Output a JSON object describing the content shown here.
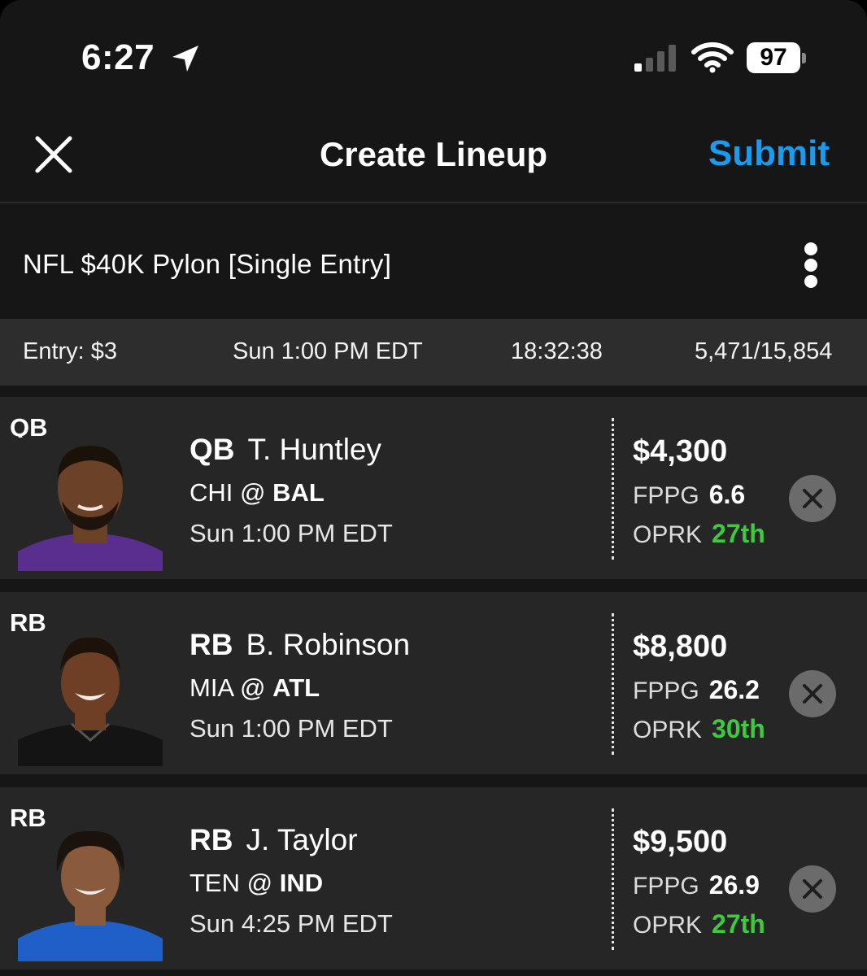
{
  "status_bar": {
    "time": "6:27",
    "battery": "97",
    "icons": [
      "location-arrow-icon",
      "cellular-signal-icon",
      "wifi-icon",
      "battery-icon"
    ]
  },
  "nav": {
    "title": "Create Lineup",
    "submit_label": "Submit",
    "close_icon": "close-icon",
    "accent_color": "#1a9bf0"
  },
  "contest": {
    "name": "NFL $40K Pylon [Single Entry]",
    "more_icon": "more-vertical-icon"
  },
  "info_bar": {
    "entry": "Entry: $3",
    "start_time": "Sun 1:00 PM EDT",
    "countdown": "18:32:38",
    "entries": "5,471/15,854"
  },
  "players": [
    {
      "slot": "QB",
      "position": "QB",
      "name": "T. Huntley",
      "away": "CHI @",
      "home": "BAL",
      "game_time": "Sun 1:00 PM EDT",
      "salary": "$4,300",
      "fppg_label": "FPPG",
      "fppg": "6.6",
      "oprk_label": "OPRK",
      "oprk": "27th",
      "jersey_color": "#5a2e8f"
    },
    {
      "slot": "RB",
      "position": "RB",
      "name": "B. Robinson",
      "away": "MIA @",
      "home": "ATL",
      "game_time": "Sun 1:00 PM EDT",
      "salary": "$8,800",
      "fppg_label": "FPPG",
      "fppg": "26.2",
      "oprk_label": "OPRK",
      "oprk": "30th",
      "jersey_color": "#1a1a1a"
    },
    {
      "slot": "RB",
      "position": "RB",
      "name": "J. Taylor",
      "away": "TEN @",
      "home": "IND",
      "game_time": "Sun 4:25 PM EDT",
      "salary": "$9,500",
      "fppg_label": "FPPG",
      "fppg": "26.9",
      "oprk_label": "OPRK",
      "oprk": "27th",
      "jersey_color": "#1f5fc8"
    }
  ],
  "colors": {
    "rank_green": "#3ec93e",
    "row_bg": "#262626",
    "info_bar_bg": "#2d2d2d"
  }
}
